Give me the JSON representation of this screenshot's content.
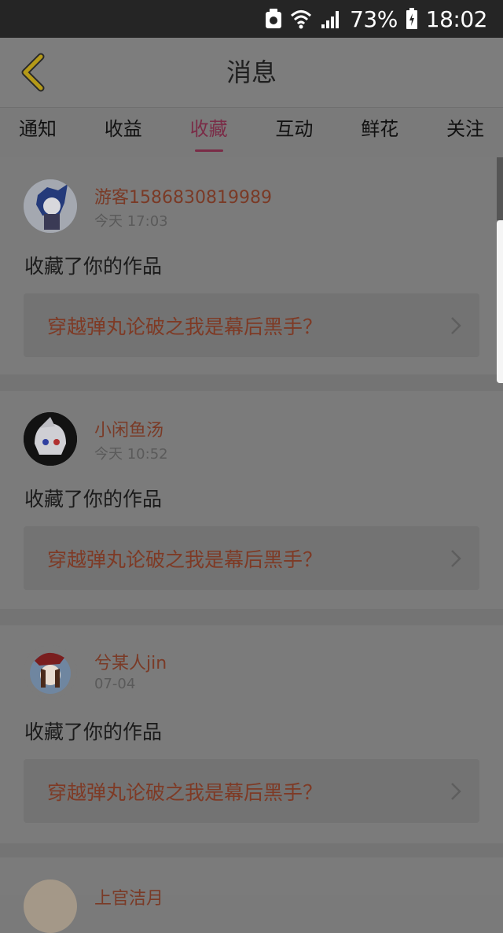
{
  "status_bar": {
    "battery": "73%",
    "time": "18:02"
  },
  "header": {
    "title": "消息",
    "back_icon": "chevron-left-icon",
    "accent": "#e0c020"
  },
  "tabs": [
    {
      "label": "通知",
      "active": false
    },
    {
      "label": "收益",
      "active": false
    },
    {
      "label": "收藏",
      "active": true
    },
    {
      "label": "互动",
      "active": false
    },
    {
      "label": "鲜花",
      "active": false
    },
    {
      "label": "关注",
      "active": false
    }
  ],
  "items": [
    {
      "username": "游客1586830819989",
      "time": "今天 17:03",
      "action": "收藏了你的作品",
      "work": "穿越弹丸论破之我是幕后黑手？"
    },
    {
      "username": "小闲鱼汤",
      "time": "今天 10:52",
      "action": "收藏了你的作品",
      "work": "穿越弹丸论破之我是幕后黑手？"
    },
    {
      "username": "兮某人jin",
      "time": "07-04",
      "action": "收藏了你的作品",
      "work": "穿越弹丸论破之我是幕后黑手？"
    },
    {
      "username": "上官洁月"
    }
  ]
}
